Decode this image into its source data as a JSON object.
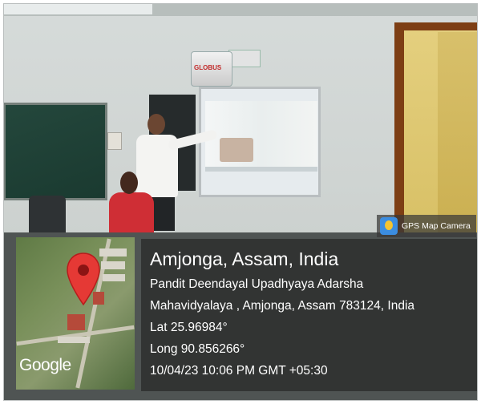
{
  "location": {
    "title": "Amjonga, Assam, India",
    "address_line1": "Pandit Deendayal Upadhyaya Adarsha",
    "address_line2": "Mahavidyalaya , Amjonga, Assam 783124, India",
    "latitude": "Lat 25.96984°",
    "longitude": "Long 90.856266°",
    "timestamp": "10/04/23 10:06 PM GMT +05:30"
  },
  "app_badge": {
    "label": "GPS Map Camera",
    "icon": "gps-map-camera-icon"
  },
  "map": {
    "attribution": "Google",
    "pin_icon": "location-pin-icon",
    "pin_color": "#e53935"
  },
  "photo": {
    "projector_brand": "GLOBUS"
  },
  "colors": {
    "overlay": "#212121",
    "text": "#ffffff"
  }
}
